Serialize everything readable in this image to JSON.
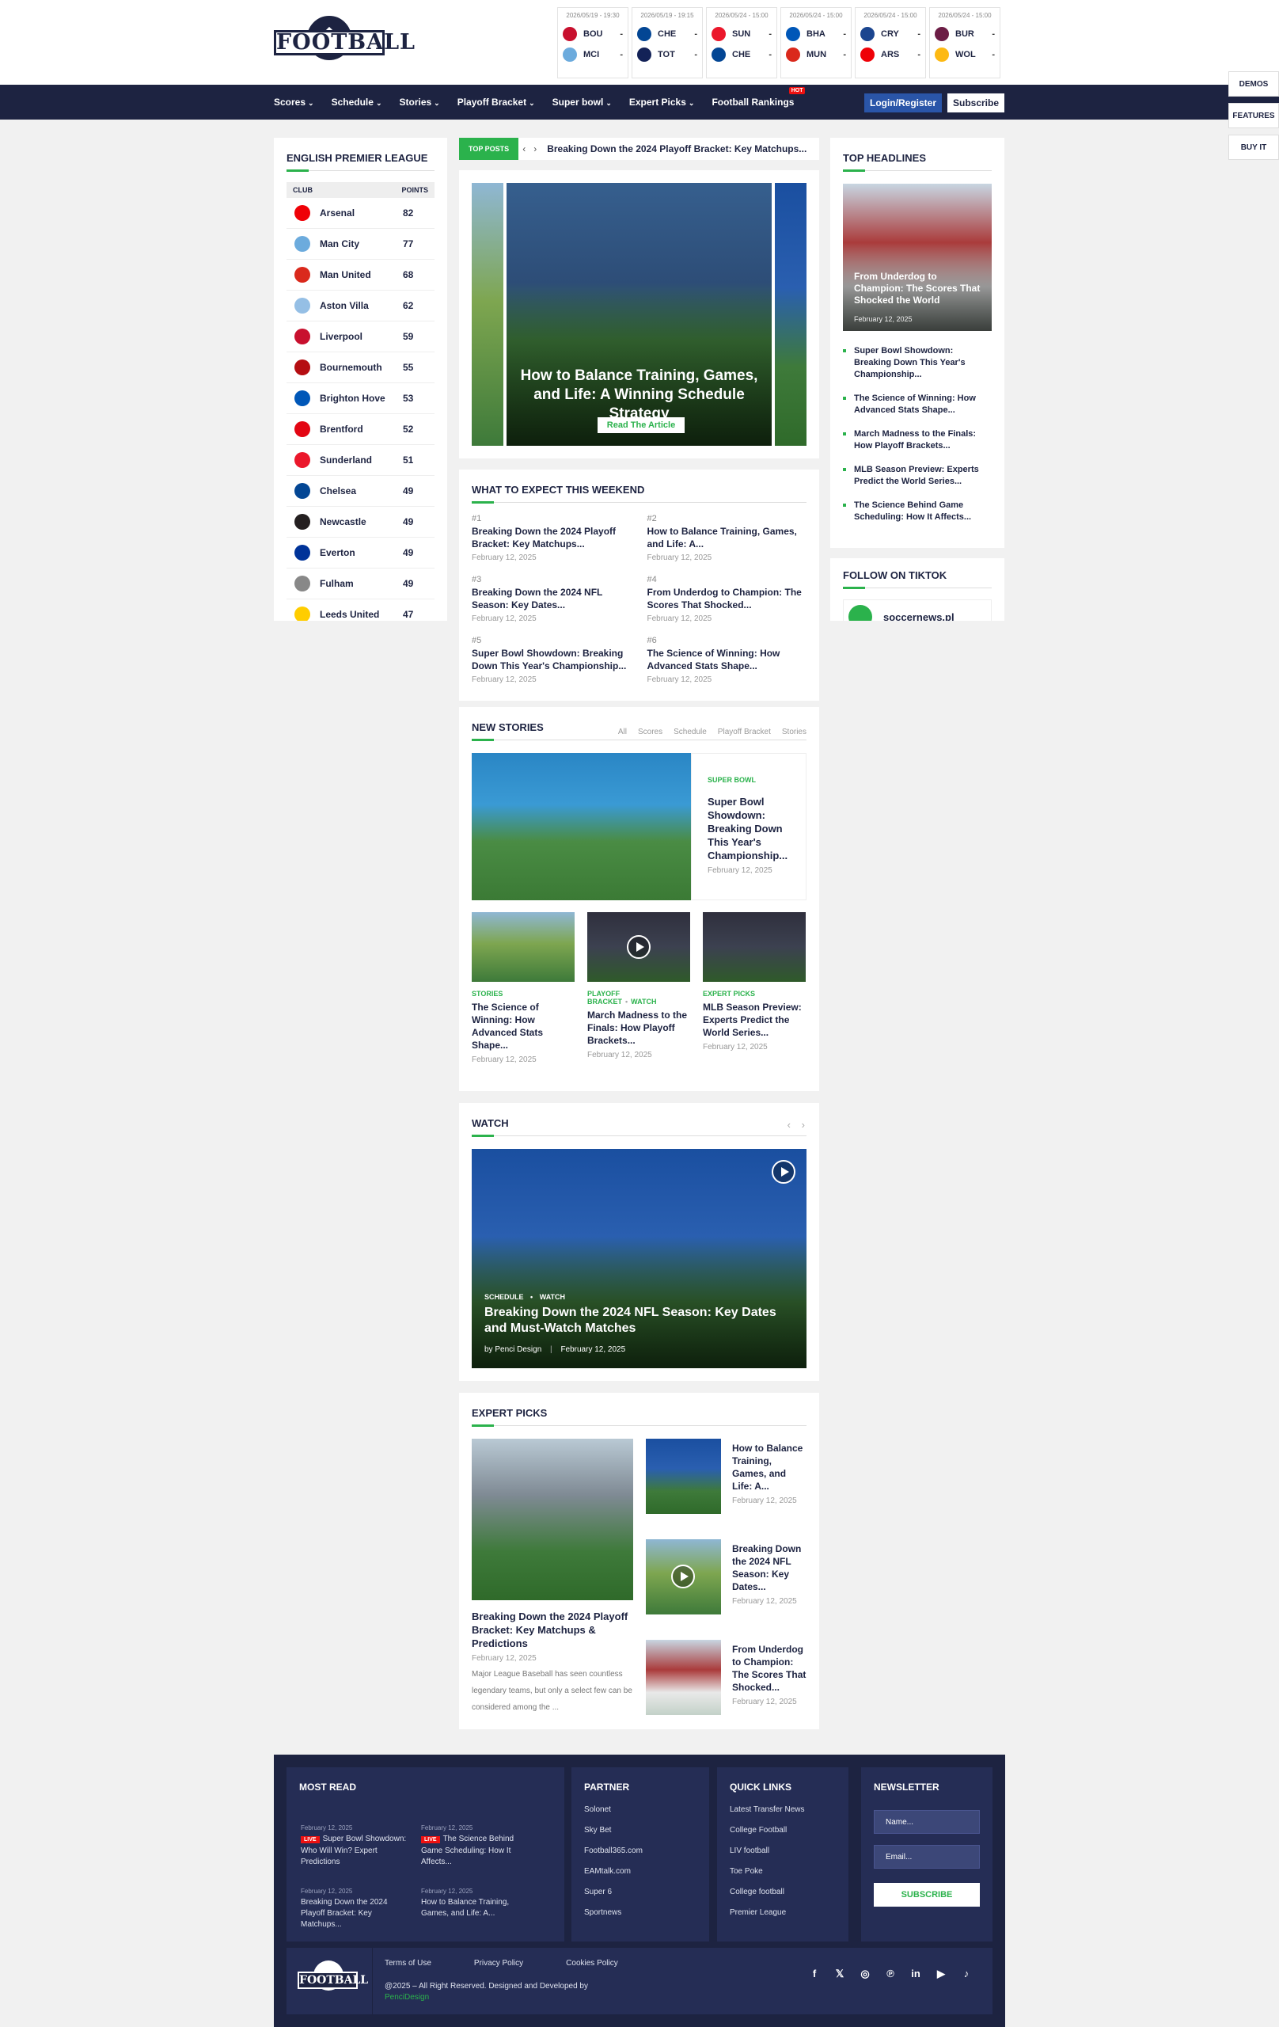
{
  "header": {
    "logo_text": "FOOTBALL",
    "matches": [
      {
        "date": "2026/05/19 - 19:30",
        "home": "BOU",
        "away": "MCI",
        "home_score": "-",
        "away_score": "-",
        "home_color": "#c8102e",
        "away_color": "#6cabdd"
      },
      {
        "date": "2026/05/19 - 19:15",
        "home": "CHE",
        "away": "TOT",
        "home_score": "-",
        "away_score": "-",
        "home_color": "#034694",
        "away_color": "#132257"
      },
      {
        "date": "2026/05/24 - 15:00",
        "home": "SUN",
        "away": "CHE",
        "home_score": "-",
        "away_score": "-",
        "home_color": "#eb172b",
        "away_color": "#034694"
      },
      {
        "date": "2026/05/24 - 15:00",
        "home": "BHA",
        "away": "MUN",
        "home_score": "-",
        "away_score": "-",
        "home_color": "#0057b8",
        "away_color": "#da291c"
      },
      {
        "date": "2026/05/24 - 15:00",
        "home": "CRY",
        "away": "ARS",
        "home_score": "-",
        "away_score": "-",
        "home_color": "#1b458f",
        "away_color": "#ef0107"
      },
      {
        "date": "2026/05/24 - 15:00",
        "home": "BUR",
        "away": "WOL",
        "home_score": "-",
        "away_score": "-",
        "home_color": "#6c1d45",
        "away_color": "#fdb913"
      }
    ]
  },
  "nav": {
    "items": [
      "Scores",
      "Schedule",
      "Stories",
      "Playoff Bracket",
      "Super bowl",
      "Expert Picks",
      "Football Rankings"
    ],
    "hot_label": "HOT",
    "login_label": "Login/Register",
    "subscribe_label": "Subscribe"
  },
  "side_buttons": [
    "DEMOS",
    "FEATURES",
    "BUY IT"
  ],
  "epl": {
    "title": "ENGLISH PREMIER LEAGUE",
    "col_club": "CLUB",
    "col_points": "POINTS",
    "rows": [
      {
        "club": "Arsenal",
        "points": "82",
        "color": "#ef0107"
      },
      {
        "club": "Man City",
        "points": "77",
        "color": "#6cabdd"
      },
      {
        "club": "Man United",
        "points": "68",
        "color": "#da291c"
      },
      {
        "club": "Aston Villa",
        "points": "62",
        "color": "#95bfe5"
      },
      {
        "club": "Liverpool",
        "points": "59",
        "color": "#c8102e"
      },
      {
        "club": "Bournemouth",
        "points": "55",
        "color": "#b50e12"
      },
      {
        "club": "Brighton Hove",
        "points": "53",
        "color": "#0057b8"
      },
      {
        "club": "Brentford",
        "points": "52",
        "color": "#e30613"
      },
      {
        "club": "Sunderland",
        "points": "51",
        "color": "#eb172b"
      },
      {
        "club": "Chelsea",
        "points": "49",
        "color": "#034694"
      },
      {
        "club": "Newcastle",
        "points": "49",
        "color": "#241f20"
      },
      {
        "club": "Everton",
        "points": "49",
        "color": "#003399"
      },
      {
        "club": "Fulham",
        "points": "49",
        "color": "#888888"
      },
      {
        "club": "Leeds United",
        "points": "47",
        "color": "#ffcd00"
      }
    ]
  },
  "top_posts": {
    "tag": "TOP POSTS",
    "text": "Breaking Down the 2024 Playoff Bracket: Key Matchups..."
  },
  "slider": {
    "title": "How to Balance Training, Games, and Life: A Winning Schedule Strategy",
    "button": "Read The Article"
  },
  "weekend": {
    "title": "WHAT TO EXPECT THIS WEEKEND",
    "items": [
      {
        "num": "#1",
        "title": "Breaking Down the 2024 Playoff Bracket: Key Matchups...",
        "date": "February 12, 2025"
      },
      {
        "num": "#2",
        "title": "How to Balance Training, Games, and Life: A...",
        "date": "February 12, 2025"
      },
      {
        "num": "#3",
        "title": "Breaking Down the 2024 NFL Season: Key Dates...",
        "date": "February 12, 2025"
      },
      {
        "num": "#4",
        "title": "From Underdog to Champion: The Scores That Shocked...",
        "date": "February 12, 2025"
      },
      {
        "num": "#5",
        "title": "Super Bowl Showdown: Breaking Down This Year's Championship...",
        "date": "February 12, 2025"
      },
      {
        "num": "#6",
        "title": "The Science of Winning: How Advanced Stats Shape...",
        "date": "February 12, 2025"
      }
    ]
  },
  "new_stories": {
    "title": "NEW STORIES",
    "tabs": [
      "All",
      "Scores",
      "Schedule",
      "Playoff Bracket",
      "Stories"
    ],
    "featured": {
      "cat": "SUPER BOWL",
      "title": "Super Bowl Showdown: Breaking Down This Year's Championship...",
      "date": "February 12, 2025"
    },
    "items": [
      {
        "cat": "STORIES",
        "cat2": "",
        "title": "The Science of Winning: How Advanced Stats Shape...",
        "date": "February 12, 2025"
      },
      {
        "cat": "PLAYOFF BRACKET",
        "cat2": "WATCH",
        "title": "March Madness to the Finals: How Playoff Brackets...",
        "date": "February 12, 2025"
      },
      {
        "cat": "EXPERT PICKS",
        "cat2": "",
        "title": "MLB Season Preview: Experts Predict the World Series...",
        "date": "February 12, 2025"
      }
    ]
  },
  "watch": {
    "title": "WATCH",
    "cat1": "SCHEDULE",
    "cat2": "WATCH",
    "headline": "Breaking Down the 2024 NFL Season: Key Dates and Must-Watch Matches",
    "author": "by Penci Design",
    "date": "February 12, 2025"
  },
  "expert": {
    "title": "EXPERT PICKS",
    "main": {
      "title": "Breaking Down the 2024 Playoff Bracket: Key Matchups & Predictions",
      "date": "February 12, 2025",
      "excerpt": "Major League Baseball has seen countless legendary teams, but only a select few can be considered among the ..."
    },
    "items": [
      {
        "title": "How to Balance Training, Games, and Life: A...",
        "date": "February 12, 2025"
      },
      {
        "title": "Breaking Down the 2024 NFL Season: Key Dates...",
        "date": "February 12, 2025"
      },
      {
        "title": "From Underdog to Champion: The Scores That Shocked...",
        "date": "February 12, 2025"
      }
    ]
  },
  "headlines": {
    "title": "TOP HEADLINES",
    "featured_title": "From Underdog to Champion: The Scores That Shocked the World",
    "featured_date": "February 12, 2025",
    "items": [
      "Super Bowl Showdown: Breaking Down This Year's Championship...",
      "The Science of Winning: How Advanced Stats Shape...",
      "March Madness to the Finals: How Playoff Brackets...",
      "MLB Season Preview: Experts Predict the World Series...",
      "The Science Behind Game Scheduling: How It Affects..."
    ]
  },
  "tiktok": {
    "title": "FOLLOW ON TIKTOK",
    "handle": "soccernews.pl"
  },
  "footer": {
    "most_read_title": "MOST READ",
    "most_read": [
      {
        "date": "February 12, 2025",
        "live": "LIVE",
        "title": "Super Bowl Showdown: Who Will Win? Expert Predictions"
      },
      {
        "date": "February 12, 2025",
        "live": "LIVE",
        "title": "The Science Behind Game Scheduling: How It Affects..."
      },
      {
        "date": "February 12, 2025",
        "live": "",
        "title": "Breaking Down the 2024 Playoff Bracket: Key Matchups..."
      },
      {
        "date": "February 12, 2025",
        "live": "",
        "title": "How to Balance Training, Games, and Life: A..."
      }
    ],
    "partner_title": "PARTNER",
    "partners": [
      "Solonet",
      "Sky Bet",
      "Football365.com",
      "EAMtalk.com",
      "Super 6",
      "Sportnews"
    ],
    "quick_title": "QUICK LINKS",
    "quick": [
      "Latest Transfer News",
      "College Football",
      "LIV football",
      "Toe Poke",
      "College football",
      "Premier League"
    ],
    "newsletter_title": "NEWSLETTER",
    "name_placeholder": "Name...",
    "email_placeholder": "Email...",
    "subscribe": "SUBSCRIBE",
    "bottom_links": [
      "Terms of Use",
      "Privacy Policy",
      "Cookies Policy"
    ],
    "copyright": "@2025 – All Right Reserved. Designed and Developed by",
    "copyright_link": "PenciDesign",
    "social": [
      "f",
      "𝕏",
      "◎",
      "℗",
      "in",
      "▶",
      "♪"
    ]
  }
}
